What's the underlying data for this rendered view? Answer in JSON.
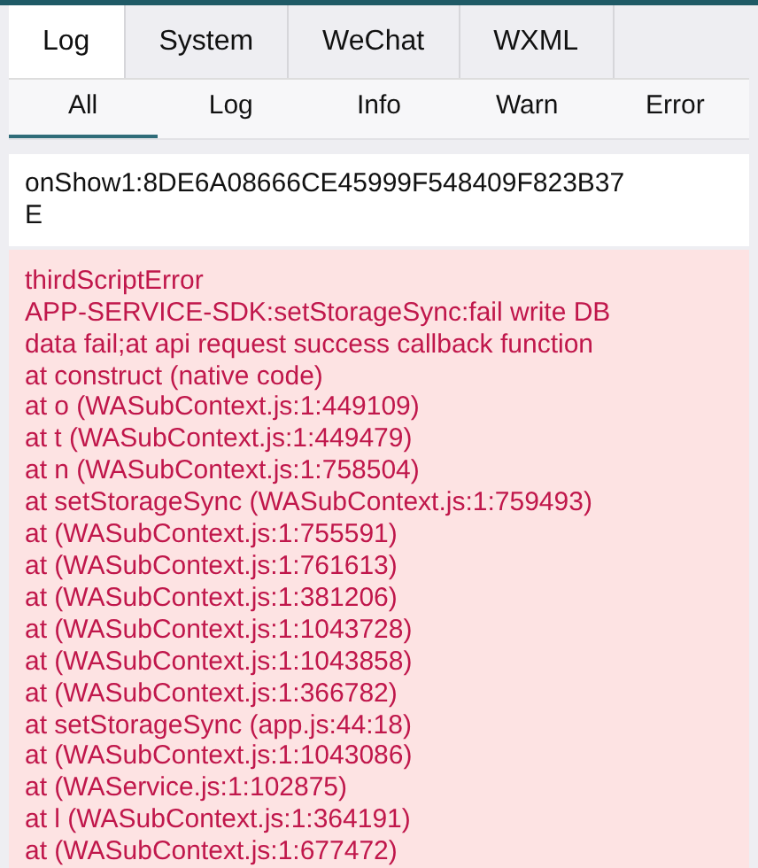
{
  "tabs": [
    {
      "label": "Log",
      "selected": true
    },
    {
      "label": "System",
      "selected": false
    },
    {
      "label": "WeChat",
      "selected": false
    },
    {
      "label": "WXML",
      "selected": false
    }
  ],
  "filters": [
    {
      "label": "All",
      "selected": true
    },
    {
      "label": "Log",
      "selected": false
    },
    {
      "label": "Info",
      "selected": false
    },
    {
      "label": "Warn",
      "selected": false
    },
    {
      "label": "Error",
      "selected": false
    }
  ],
  "entries": [
    {
      "kind": "log",
      "lines": [
        "onShow1:8DE6A08666CE45999F548409F823B37",
        "E"
      ]
    },
    {
      "kind": "error",
      "lines": [
        "thirdScriptError",
        "APP-SERVICE-SDK:setStorageSync:fail write DB",
        "data fail;at api request success callback function",
        "at construct (native code)",
        "at o (WASubContext.js:1:449109)",
        "at t (WASubContext.js:1:449479)",
        "at n (WASubContext.js:1:758504)",
        "at setStorageSync (WASubContext.js:1:759493)",
        "at (WASubContext.js:1:755591)",
        "at (WASubContext.js:1:761613)",
        "at (WASubContext.js:1:381206)",
        "at (WASubContext.js:1:1043728)",
        "at (WASubContext.js:1:1043858)",
        "at (WASubContext.js:1:366782)",
        "at setStorageSync (app.js:44:18)",
        "at (WASubContext.js:1:1043086)",
        "at (WAService.js:1:102875)",
        "at l (WASubContext.js:1:364191)",
        "at (WASubContext.js:1:677472)"
      ]
    }
  ]
}
